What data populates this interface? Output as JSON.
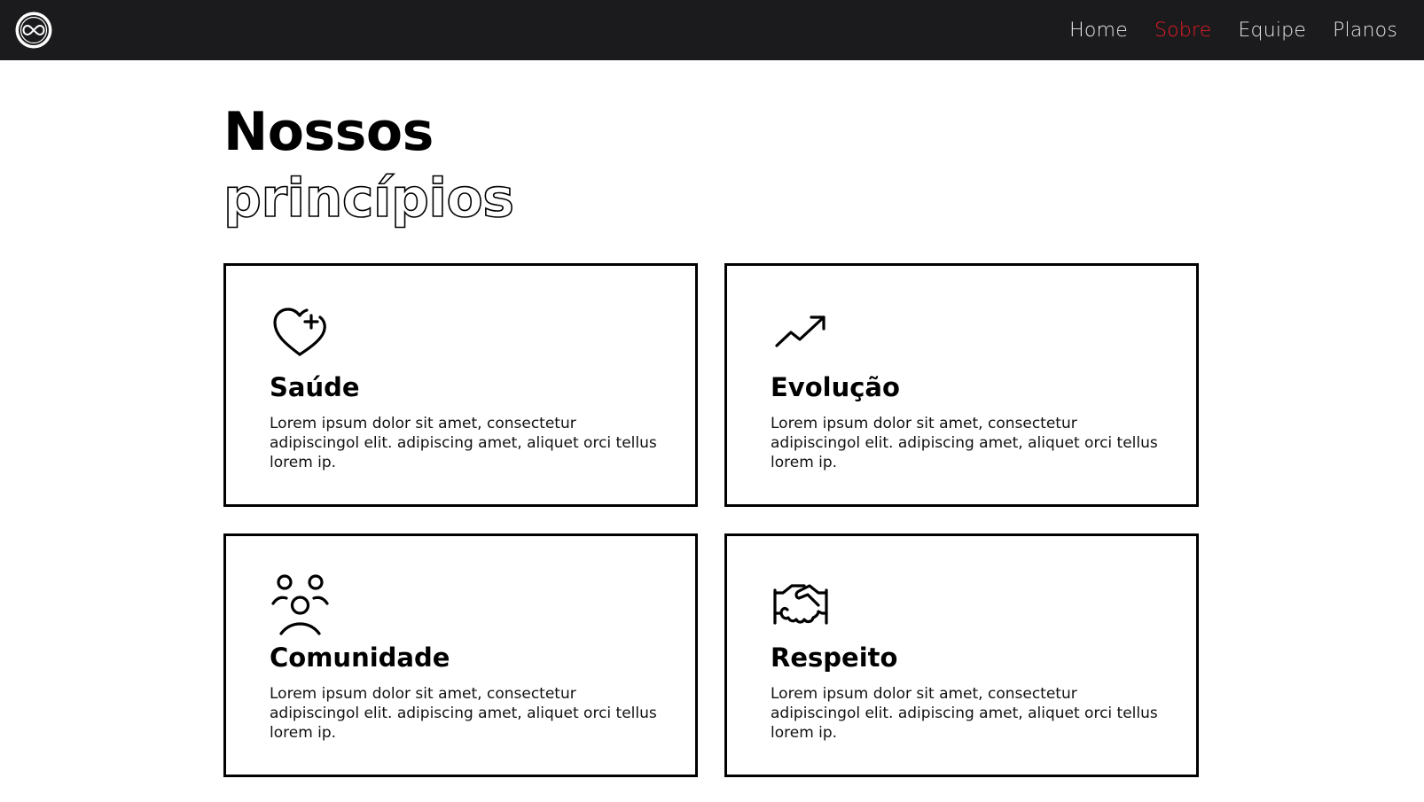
{
  "navbar": {
    "logo_icon": "infinity-logo-icon",
    "links": [
      {
        "label": "Home",
        "active": false
      },
      {
        "label": "Sobre",
        "active": true
      },
      {
        "label": "Equipe",
        "active": false
      },
      {
        "label": "Planos",
        "active": false
      }
    ],
    "active_color": "#e01b24",
    "background": "#1b1b1d"
  },
  "section": {
    "title_line1": "Nossos",
    "title_line2": "princípios"
  },
  "cards": [
    {
      "icon": "heart-plus-icon",
      "title": "Saúde",
      "text": "Lorem ipsum dolor sit amet, consectetur adipiscingol elit. adipiscing amet, aliquet orci tellus lorem ip."
    },
    {
      "icon": "trending-up-icon",
      "title": "Evolução",
      "text": "Lorem ipsum dolor sit amet, consectetur adipiscingol elit. adipiscing amet, aliquet orci tellus lorem ip."
    },
    {
      "icon": "community-icon",
      "title": "Comunidade",
      "text": "Lorem ipsum dolor sit amet, consectetur adipiscingol elit. adipiscing amet, aliquet orci tellus lorem ip."
    },
    {
      "icon": "handshake-icon",
      "title": "Respeito",
      "text": "Lorem ipsum dolor sit amet, consectetur adipiscingol elit. adipiscing amet, aliquet orci tellus lorem ip."
    }
  ]
}
